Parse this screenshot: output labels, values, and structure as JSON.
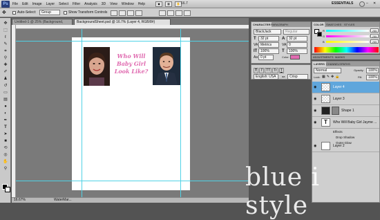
{
  "menubar": {
    "logo": "Ps",
    "items": [
      "File",
      "Edit",
      "Image",
      "Layer",
      "Select",
      "Filter",
      "Analysis",
      "3D",
      "View",
      "Window",
      "Help"
    ],
    "zoom": "16.7",
    "workspace": "ESSENTIALS"
  },
  "options_bar": {
    "auto_select_label": "Auto-Select:",
    "auto_select_value": "Group",
    "transform_controls_label": "Show Transform Controls"
  },
  "doc_tabs": [
    {
      "label": "Untitled-1 @ 25% (Background, RGB/8)"
    },
    {
      "label": "BackgroundSheet.psd @ 16.7% (Layer 4, RGB/8#)"
    }
  ],
  "document": {
    "title_lines": [
      "Who Will",
      "Baby Girl",
      "Look Like?"
    ]
  },
  "status": {
    "zoom": "16.67%",
    "taskbar_item": "WaterMar..."
  },
  "character_panel": {
    "tabs": [
      "CHARACTER",
      "PARAGRAPH"
    ],
    "font_family": "BlackJack",
    "font_style": "Regular",
    "font_size": "32 pt",
    "leading": "32 pt",
    "kerning": "Metrics",
    "tracking": "0",
    "vscale": "100%",
    "hscale": "100%",
    "baseline": "0 pt",
    "color_label": "Color:",
    "language": "English: USA",
    "aa_label": "aa",
    "aa_value": "Crisp"
  },
  "color_panel": {
    "tabs": [
      "COLOR",
      "SWATCHES",
      "STYLES"
    ],
    "channels": [
      {
        "label": "R",
        "value": "255",
        "color": "#ff2a2a"
      },
      {
        "label": "G",
        "value": "255",
        "color": "#2aa02a"
      },
      {
        "label": "B",
        "value": "255",
        "color": "#2a4adf"
      }
    ]
  },
  "adjustments": {
    "tabs": [
      "ADJUSTMENTS",
      "MASKS"
    ]
  },
  "layers_panel": {
    "tabs": [
      "LAYERS",
      "CHANNELS",
      "PATHS"
    ],
    "blend_mode": "Normal",
    "opacity_label": "Opacity:",
    "opacity": "100%",
    "lock_label": "Lock:",
    "fill_label": "Fill:",
    "fill": "100%",
    "layers": [
      {
        "name": "Layer 4",
        "selected": true
      },
      {
        "name": "Layer 3",
        "selected": false
      },
      {
        "name": "Shape 1",
        "selected": false
      },
      {
        "name": "Who Will Baby Girl Jayme ...",
        "selected": false
      },
      {
        "name": "Layer 2",
        "selected": false
      }
    ],
    "effects_label": "Effects",
    "effects": [
      "Drop Shadow",
      "Outer Glow"
    ]
  },
  "watermark": "blue i style"
}
